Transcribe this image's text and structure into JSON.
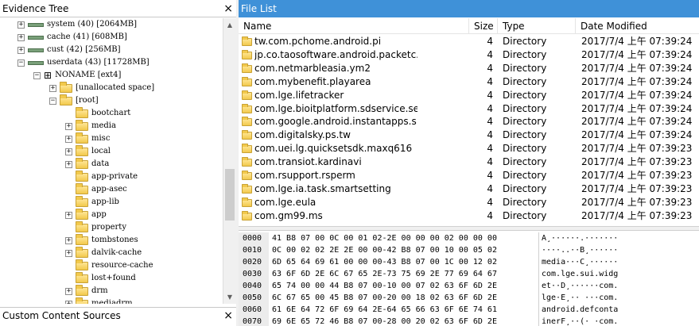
{
  "left_panel": {
    "title": "Evidence Tree",
    "close_glyph": "×",
    "scroll_up": "▲",
    "scroll_down": "▼"
  },
  "tree": [
    {
      "label": "system (40) [2064MB]",
      "expander": "+",
      "icon": "drive"
    },
    {
      "label": "cache (41) [608MB]",
      "expander": "+",
      "icon": "drive"
    },
    {
      "label": "cust (42) [256MB]",
      "expander": "+",
      "icon": "drive"
    },
    {
      "label": "userdata (43) [11728MB]",
      "expander": "−",
      "icon": "drive"
    },
    {
      "label": "NONAME [ext4]",
      "expander": "−",
      "icon": "filesystem"
    },
    {
      "label": "[unallocated space]",
      "expander": "+",
      "icon": "folder"
    },
    {
      "label": "[root]",
      "expander": "−",
      "icon": "folder"
    },
    {
      "label": "bootchart",
      "expander": "",
      "icon": "folder"
    },
    {
      "label": "media",
      "expander": "+",
      "icon": "folder"
    },
    {
      "label": "misc",
      "expander": "+",
      "icon": "folder"
    },
    {
      "label": "local",
      "expander": "+",
      "icon": "folder"
    },
    {
      "label": "data",
      "expander": "+",
      "icon": "folder"
    },
    {
      "label": "app-private",
      "expander": "",
      "icon": "folder"
    },
    {
      "label": "app-asec",
      "expander": "",
      "icon": "folder"
    },
    {
      "label": "app-lib",
      "expander": "",
      "icon": "folder"
    },
    {
      "label": "app",
      "expander": "+",
      "icon": "folder"
    },
    {
      "label": "property",
      "expander": "",
      "icon": "folder"
    },
    {
      "label": "tombstones",
      "expander": "+",
      "icon": "folder"
    },
    {
      "label": "dalvik-cache",
      "expander": "+",
      "icon": "folder"
    },
    {
      "label": "resource-cache",
      "expander": "",
      "icon": "folder"
    },
    {
      "label": "lost+found",
      "expander": "",
      "icon": "folder"
    },
    {
      "label": "drm",
      "expander": "+",
      "icon": "folder"
    },
    {
      "label": "mediadrm",
      "expander": "+",
      "icon": "folder"
    }
  ],
  "custom_sources": {
    "title": "Custom Content Sources",
    "close_glyph": "×"
  },
  "file_list": {
    "title": "File List",
    "headers": {
      "name": "Name",
      "size": "Size",
      "type": "Type",
      "date": "Date Modified"
    },
    "rows": [
      {
        "name": "tw.com.pchome.android.pi",
        "size": "4",
        "type": "Directory",
        "date": "2017/7/4 上午 07:39:24"
      },
      {
        "name": "jp.co.taosoftware.android.packetc...",
        "size": "4",
        "type": "Directory",
        "date": "2017/7/4 上午 07:39:24"
      },
      {
        "name": "com.netmarbleasia.ym2",
        "size": "4",
        "type": "Directory",
        "date": "2017/7/4 上午 07:39:24"
      },
      {
        "name": "com.mybenefit.playarea",
        "size": "4",
        "type": "Directory",
        "date": "2017/7/4 上午 07:39:24"
      },
      {
        "name": "com.lge.lifetracker",
        "size": "4",
        "type": "Directory",
        "date": "2017/7/4 上午 07:39:24"
      },
      {
        "name": "com.lge.bioitplatform.sdservice.se...",
        "size": "4",
        "type": "Directory",
        "date": "2017/7/4 上午 07:39:24"
      },
      {
        "name": "com.google.android.instantapps.s...",
        "size": "4",
        "type": "Directory",
        "date": "2017/7/4 上午 07:39:24"
      },
      {
        "name": "com.digitalsky.ps.tw",
        "size": "4",
        "type": "Directory",
        "date": "2017/7/4 上午 07:39:24"
      },
      {
        "name": "com.uei.lg.quicksetsdk.maxq616",
        "size": "4",
        "type": "Directory",
        "date": "2017/7/4 上午 07:39:23"
      },
      {
        "name": "com.transiot.kardinavi",
        "size": "4",
        "type": "Directory",
        "date": "2017/7/4 上午 07:39:23"
      },
      {
        "name": "com.rsupport.rsperm",
        "size": "4",
        "type": "Directory",
        "date": "2017/7/4 上午 07:39:23"
      },
      {
        "name": "com.lge.ia.task.smartsetting",
        "size": "4",
        "type": "Directory",
        "date": "2017/7/4 上午 07:39:23"
      },
      {
        "name": "com.lge.eula",
        "size": "4",
        "type": "Directory",
        "date": "2017/7/4 上午 07:39:23"
      },
      {
        "name": "com.gm99.ms",
        "size": "4",
        "type": "Directory",
        "date": "2017/7/4 上午 07:39:23"
      }
    ]
  },
  "hex_view": [
    {
      "offset": "0000",
      "bytes": "41 B8 07 00 0C 00 01 02-2E 00 00 00 02 00 00 00",
      "ascii": "A¸······.·······"
    },
    {
      "offset": "0010",
      "bytes": "0C 00 02 02 2E 2E 00 00-42 B8 07 00 10 00 05 02",
      "ascii": "····..··B¸······"
    },
    {
      "offset": "0020",
      "bytes": "6D 65 64 69 61 00 00 00-43 B8 07 00 1C 00 12 02",
      "ascii": "media···C¸······"
    },
    {
      "offset": "0030",
      "bytes": "63 6F 6D 2E 6C 67 65 2E-73 75 69 2E 77 69 64 67",
      "ascii": "com.lge.sui.widg"
    },
    {
      "offset": "0040",
      "bytes": "65 74 00 00 44 B8 07 00-10 00 07 02 63 6F 6D 2E",
      "ascii": "et··D¸······com."
    },
    {
      "offset": "0050",
      "bytes": "6C 67 65 00 45 B8 07 00-20 00 18 02 63 6F 6D 2E",
      "ascii": "lge·E¸·· ···com."
    },
    {
      "offset": "0060",
      "bytes": "61 6E 64 72 6F 69 64 2E-64 65 66 63 6F 6E 74 61",
      "ascii": "android.defconta"
    },
    {
      "offset": "0070",
      "bytes": "69 6E 65 72 46 B8 07 00-28 00 20 02 63 6F 6D 2E",
      "ascii": "inerF¸··(· ·com."
    }
  ]
}
